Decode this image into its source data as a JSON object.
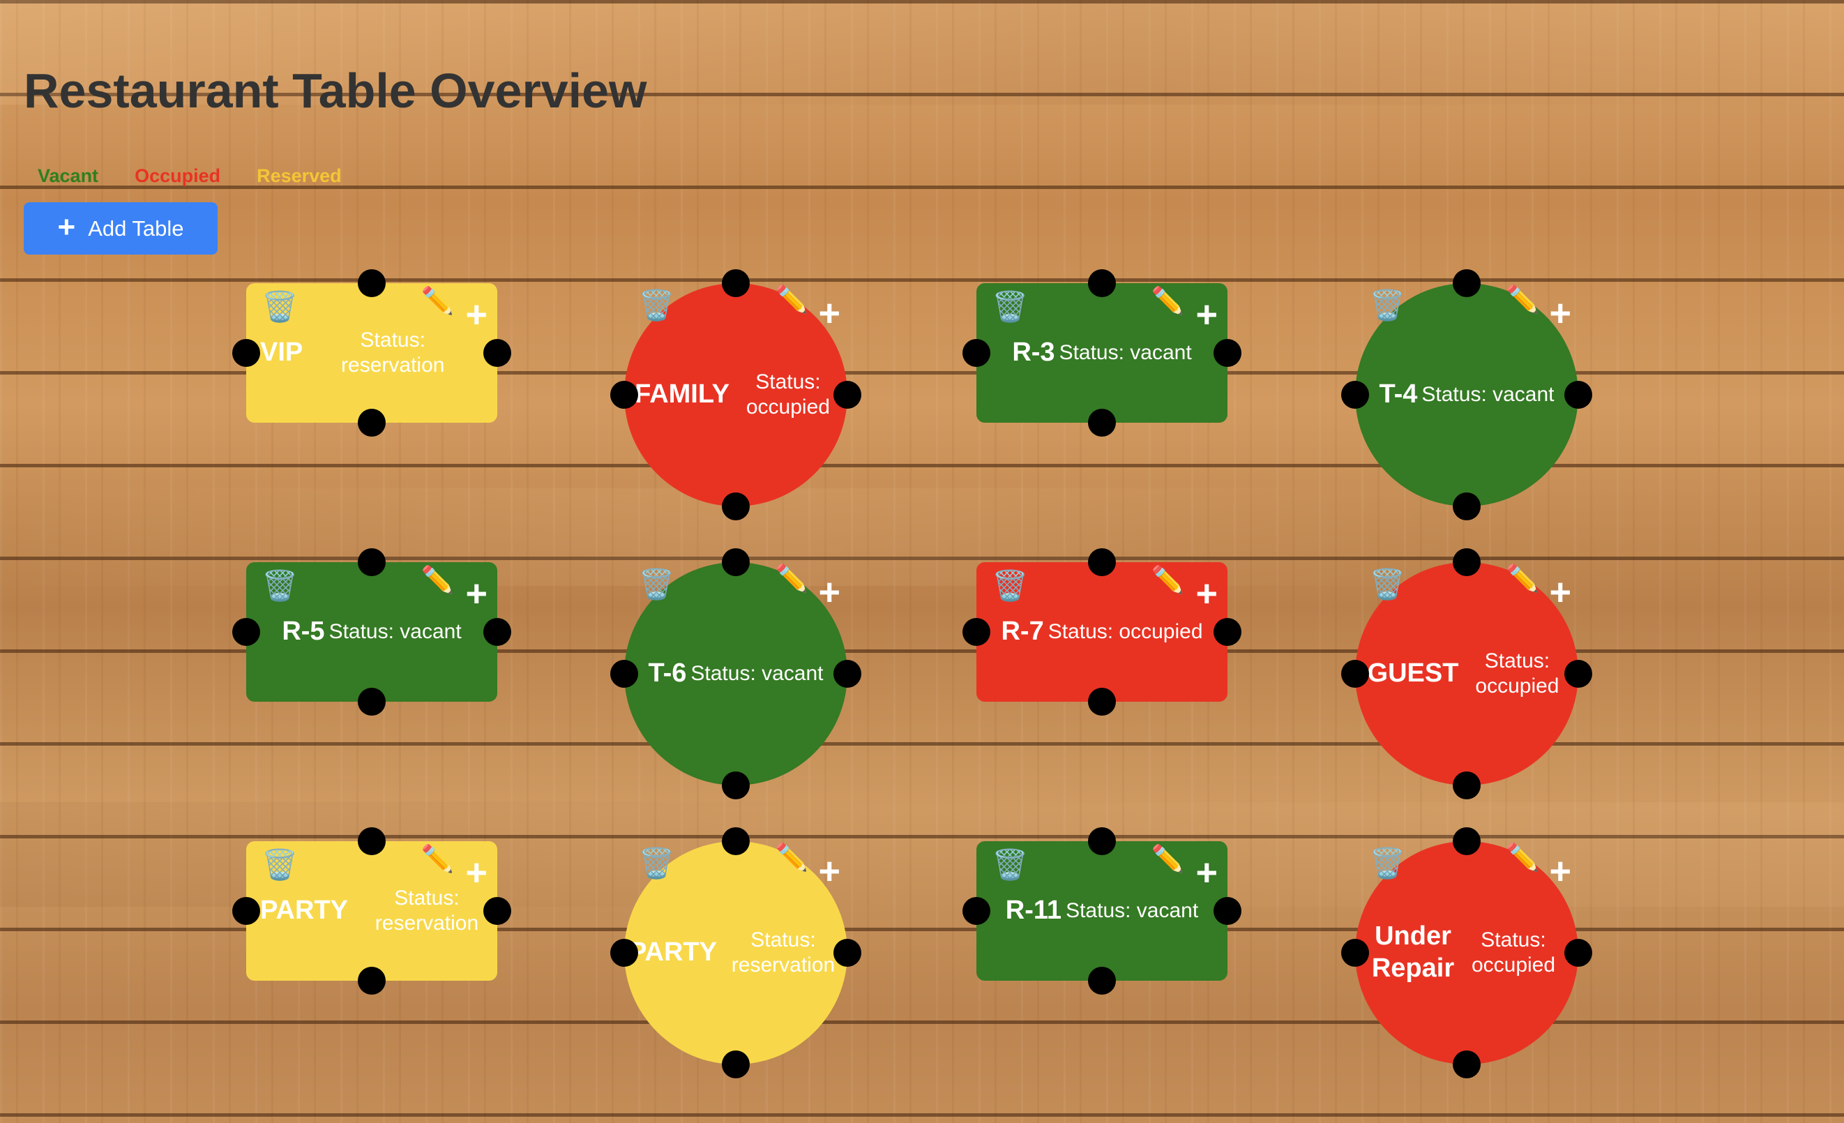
{
  "header": {
    "title": "Restaurant Table Overview"
  },
  "legend": [
    {
      "label": "Vacant",
      "color": "#2f7f1f"
    },
    {
      "label": "Occupied",
      "color": "#e83323"
    },
    {
      "label": "Reserved",
      "color": "#f3c635"
    }
  ],
  "toolbar": {
    "add_label": "Add Table",
    "add_icon": "+"
  },
  "icons": {
    "trash": "🗑️",
    "edit": "✏️",
    "add": "+"
  },
  "tables": [
    {
      "name": "VIP",
      "status": "Status: reservation",
      "state": "reserved",
      "shape": "rect"
    },
    {
      "name": "FAMILY",
      "status": "Status: occupied",
      "state": "occupied",
      "shape": "round"
    },
    {
      "name": "R-3",
      "status": "Status: vacant",
      "state": "vacant",
      "shape": "rect"
    },
    {
      "name": "T-4",
      "status": "Status: vacant",
      "state": "vacant",
      "shape": "round"
    },
    {
      "name": "R-5",
      "status": "Status: vacant",
      "state": "vacant",
      "shape": "rect"
    },
    {
      "name": "T-6",
      "status": "Status: vacant",
      "state": "vacant",
      "shape": "round"
    },
    {
      "name": "R-7",
      "status": "Status: occupied",
      "state": "occupied",
      "shape": "rect"
    },
    {
      "name": "GUEST",
      "status": "Status: occupied",
      "state": "occupied",
      "shape": "round"
    },
    {
      "name": "PARTY",
      "status": "Status: reservation",
      "state": "reserved",
      "shape": "rect"
    },
    {
      "name": "PARTY",
      "status": "Status: reservation",
      "state": "reserved",
      "shape": "round"
    },
    {
      "name": "R-11",
      "status": "Status: vacant",
      "state": "vacant",
      "shape": "rect"
    },
    {
      "name": "Under Repair",
      "status": "Status: occupied",
      "state": "occupied",
      "shape": "round"
    }
  ]
}
